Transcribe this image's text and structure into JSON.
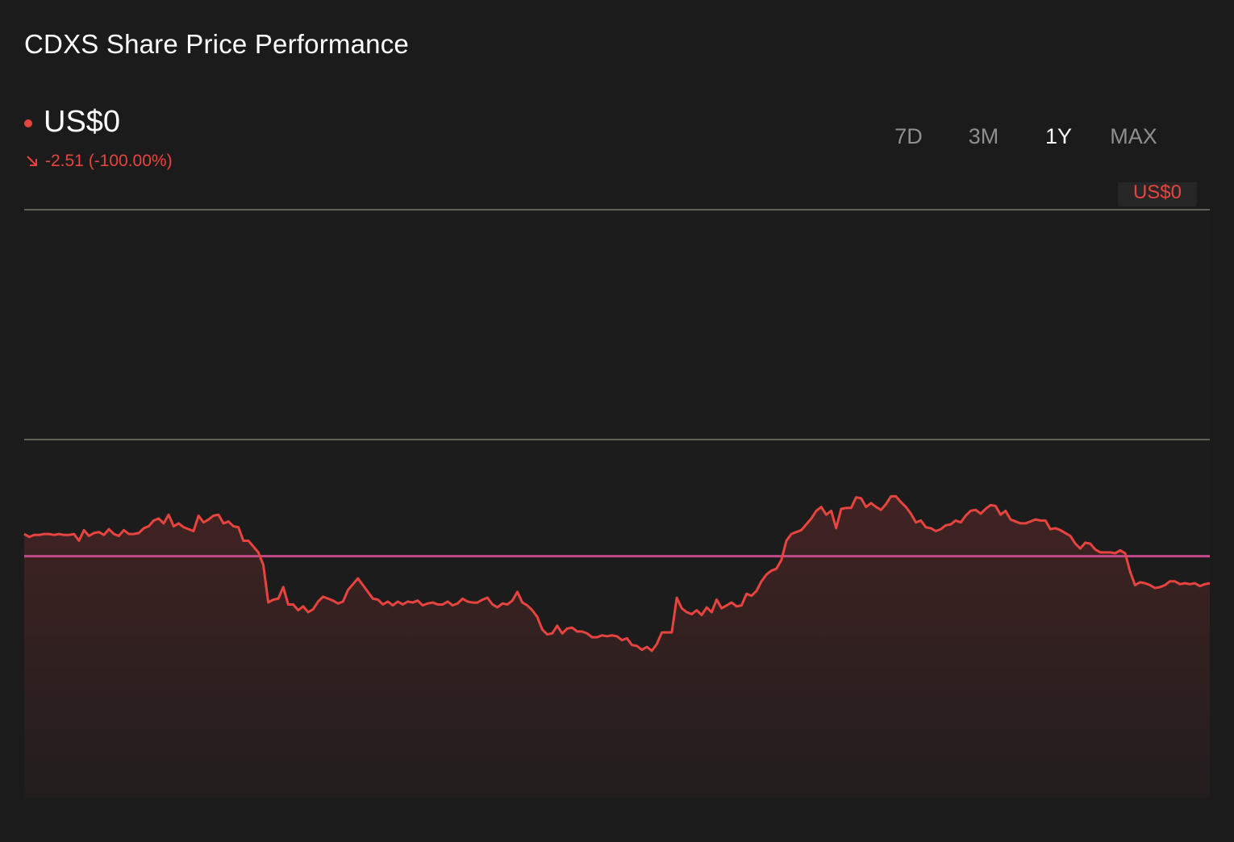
{
  "title": "CDXS Share Price Performance",
  "price": {
    "current": "US$0",
    "change": "-2.51 (-100.00%)"
  },
  "ranges": [
    {
      "label": "7D",
      "active": false
    },
    {
      "label": "3M",
      "active": false
    },
    {
      "label": "1Y",
      "active": true
    },
    {
      "label": "MAX",
      "active": false
    }
  ],
  "colors": {
    "accent_down": "#e8443f",
    "reference_line": "#c24a8a",
    "gridline": "#7a786c"
  },
  "chart_data": {
    "type": "line",
    "price_tag": "US$0",
    "reference_value": 2.51,
    "ylim": [
      0,
      6.1
    ],
    "grid": true,
    "values": [
      2.74,
      2.71,
      2.73,
      2.73,
      2.74,
      2.74,
      2.73,
      2.74,
      2.73,
      2.73,
      2.74,
      2.67,
      2.78,
      2.72,
      2.75,
      2.76,
      2.73,
      2.79,
      2.74,
      2.72,
      2.78,
      2.74,
      2.74,
      2.75,
      2.8,
      2.82,
      2.88,
      2.9,
      2.85,
      2.94,
      2.82,
      2.85,
      2.81,
      2.79,
      2.77,
      2.93,
      2.86,
      2.89,
      2.93,
      2.94,
      2.85,
      2.87,
      2.82,
      2.81,
      2.67,
      2.67,
      2.61,
      2.55,
      2.42,
      2.03,
      2.06,
      2.07,
      2.19,
      2.01,
      2.01,
      1.95,
      1.99,
      1.93,
      1.96,
      2.04,
      2.09,
      2.07,
      2.05,
      2.02,
      2.04,
      2.16,
      2.22,
      2.28,
      2.21,
      2.14,
      2.07,
      2.06,
      2.01,
      2.04,
      2.0,
      2.04,
      2.01,
      2.04,
      2.03,
      2.05,
      2.0,
      2.02,
      2.03,
      2.01,
      2.01,
      2.04,
      2.0,
      2.02,
      2.07,
      2.04,
      2.03,
      2.03,
      2.06,
      2.08,
      2.01,
      1.98,
      2.02,
      2.01,
      2.05,
      2.14,
      2.03,
      2.0,
      1.95,
      1.88,
      1.75,
      1.7,
      1.71,
      1.79,
      1.71,
      1.76,
      1.77,
      1.73,
      1.73,
      1.71,
      1.67,
      1.67,
      1.69,
      1.68,
      1.69,
      1.68,
      1.64,
      1.66,
      1.59,
      1.58,
      1.54,
      1.57,
      1.53,
      1.6,
      1.72,
      1.72,
      1.72,
      2.08,
      1.97,
      1.93,
      1.91,
      1.95,
      1.9,
      1.98,
      1.93,
      2.06,
      1.97,
      2.0,
      2.03,
      1.99,
      2.0,
      2.12,
      2.1,
      2.15,
      2.25,
      2.32,
      2.36,
      2.38,
      2.47,
      2.67,
      2.74,
      2.76,
      2.78,
      2.84,
      2.9,
      2.98,
      3.02,
      2.94,
      2.98,
      2.8,
      3.0,
      3.01,
      3.01,
      3.12,
      3.11,
      3.02,
      3.06,
      3.02,
      2.99,
      3.05,
      3.13,
      3.13,
      3.07,
      3.02,
      2.95,
      2.86,
      2.88,
      2.81,
      2.8,
      2.77,
      2.79,
      2.83,
      2.84,
      2.88,
      2.86,
      2.93,
      2.98,
      2.99,
      2.95,
      3.0,
      3.04,
      3.03,
      2.94,
      2.98,
      2.89,
      2.87,
      2.85,
      2.85,
      2.87,
      2.89,
      2.88,
      2.88,
      2.79,
      2.8,
      2.78,
      2.75,
      2.72,
      2.64,
      2.59,
      2.65,
      2.64,
      2.58,
      2.55,
      2.55,
      2.55,
      2.54,
      2.57,
      2.54,
      2.35,
      2.21,
      2.24,
      2.23,
      2.21,
      2.18,
      2.19,
      2.21,
      2.25,
      2.25,
      2.22,
      2.23,
      2.22,
      2.23,
      2.2,
      2.22,
      2.23
    ]
  }
}
